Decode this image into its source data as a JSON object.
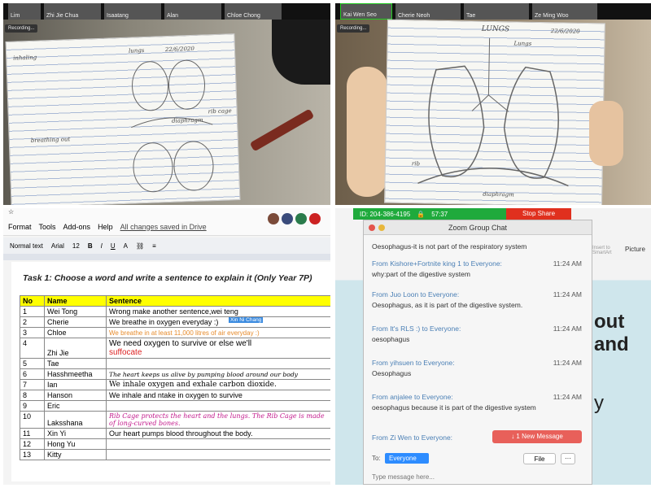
{
  "webcam_left": {
    "participants": [
      "Lim",
      "Zhi Jie Chua",
      "Isaatang",
      "Alan",
      "Chloe Chong"
    ],
    "recording": "Recording...",
    "notes": {
      "date": "22/6/2020",
      "label_lungs": "lungs",
      "label_diaphragm": "diaphragm",
      "label_rib_cage": "rib cage",
      "label_breathing_out": "breathing out"
    }
  },
  "webcam_right": {
    "participants": [
      "Kai Wen Seo",
      "Cherie Neoh",
      "Tae",
      "Ze Ming Woo"
    ],
    "recording": "Recording...",
    "notes": {
      "title": "LUNGS",
      "date": "22/6/2020",
      "label_lungs": "Lungs",
      "label_rib": "rib",
      "label_diaphragm": "diaphragm"
    }
  },
  "doc": {
    "menu": [
      "Format",
      "Tools",
      "Add-ons",
      "Help"
    ],
    "saved": "All changes saved in Drive",
    "style": "Normal text",
    "font": "Arial",
    "size": "12",
    "task": "Task 1: Choose a word and write a sentence to explain it (Only Year 7P)",
    "headers": [
      "No",
      "Name",
      "Sentence"
    ],
    "cursor_tag": "Xin Ni Chang",
    "rows": [
      {
        "no": "1",
        "name": "Wei Tong",
        "sentence": "Wrong make another sentence,wei teng"
      },
      {
        "no": "2",
        "name": "Cherie",
        "sentence": "We breathe in oxygen everyday :)"
      },
      {
        "no": "3",
        "name": "Chloe",
        "sentence": "We breathe in at least 11,000 litres of air everyday :)"
      },
      {
        "no": "4",
        "name": "Zhi Jie",
        "sentence": "We need oxygen to survive or else we'll",
        "sentence2": "suffocate"
      },
      {
        "no": "5",
        "name": "Tae",
        "sentence": ""
      },
      {
        "no": "6",
        "name": "Hasshmeetha",
        "sentence": "The heart keeps us alive by pumping blood around our body"
      },
      {
        "no": "7",
        "name": "Ian",
        "sentence": "We inhale oxygen and exhale carbon dioxide."
      },
      {
        "no": "8",
        "name": "Hanson",
        "sentence": "We inhale and ntake in oxygen to survive"
      },
      {
        "no": "9",
        "name": "Eric",
        "sentence": ""
      },
      {
        "no": "10",
        "name": "Laksshana",
        "sentence": "Rib Cage protects the heart and the lungs. The Rib Cage is made of long-curved bones."
      },
      {
        "no": "11",
        "name": "Xin Yi",
        "sentence": "Our heart pumps blood throughout the body."
      },
      {
        "no": "12",
        "name": "Hong Yu",
        "sentence": ""
      },
      {
        "no": "13",
        "name": "Kitty",
        "sentence": ""
      }
    ]
  },
  "zoom": {
    "meeting_id": "ID: 204-386-4195",
    "timer": "57:37",
    "stop_share": "Stop Share",
    "chat_title": "Zoom Group Chat",
    "top_line": "Oesophagus-it is not part of the respiratory system",
    "messages": [
      {
        "from": "From Kishore+Fortnite king 1 to Everyone:",
        "time": "11:24 AM",
        "body": "why:part of the digestive system"
      },
      {
        "from": "From Juo Loon to Everyone:",
        "time": "11:24 AM",
        "body": "Oesophagus, as it is part of the digestive system."
      },
      {
        "from": "From It's RLS :) to Everyone:",
        "time": "11:24 AM",
        "body": "oesophagus"
      },
      {
        "from": "From yihsuen to Everyone:",
        "time": "11:24 AM",
        "body": "Oesophagus"
      },
      {
        "from": "From anjalee to Everyone:",
        "time": "11:24 AM",
        "body": "oesophagus because it is part of the digestive system"
      },
      {
        "from": "From Zi Wen to Everyone:",
        "time": "",
        "body": ""
      }
    ],
    "new_message": "↓ 1 New Message",
    "to_label": "To:",
    "to_value": "Everyone",
    "file_label": "File",
    "input_placeholder": "Type message here...",
    "bg_text_1": "out and",
    "bg_text_2": "y",
    "picture_label": "Picture",
    "art_label": "Insert to SmartArt"
  },
  "colors": {
    "highlight": "#ffff00",
    "zoom_green": "#1faa3c",
    "stop_red": "#e0301e",
    "link_blue": "#4a7fb5"
  }
}
